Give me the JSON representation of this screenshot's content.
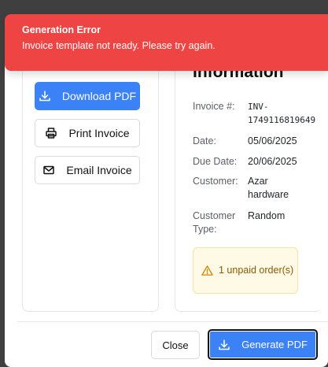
{
  "toast": {
    "title": "Generation Error",
    "message": "Invoice template not ready. Please try again.",
    "color": "#ef4444"
  },
  "actions": {
    "download_label": "Download PDF",
    "print_label": "Print Invoice",
    "email_label": "Email Invoice"
  },
  "info": {
    "heading": "Information",
    "fields": [
      {
        "label": "Invoice #:",
        "value": "INV-\n1749116819649"
      },
      {
        "label": "Date:",
        "value": "05/06/2025"
      },
      {
        "label": "Due Date:",
        "value": "20/06/2025"
      },
      {
        "label": "Customer:",
        "value": "Azar hardware"
      },
      {
        "label": "Customer Type:",
        "value": "Random"
      }
    ],
    "warning": "1 unpaid order(s)"
  },
  "footer": {
    "close_label": "Close",
    "generate_label": "Generate PDF"
  },
  "colors": {
    "primary": "#3b82f6",
    "warning_bg": "#fefae6",
    "warning_text": "#8a5a05"
  }
}
